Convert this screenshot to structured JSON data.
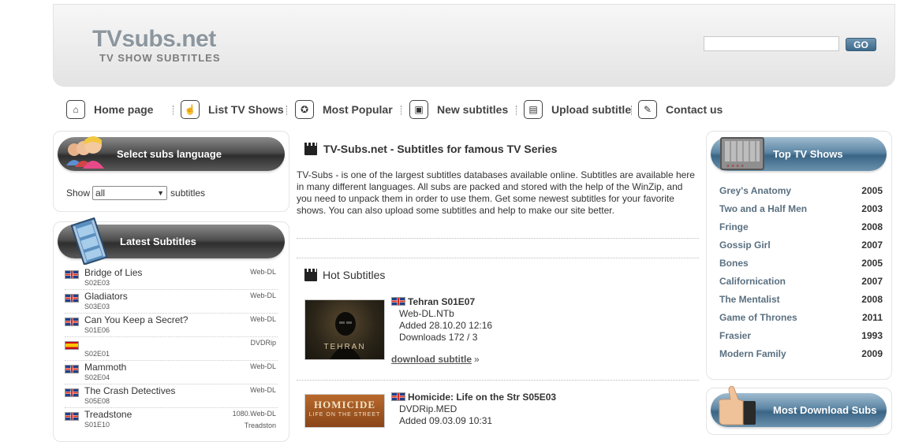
{
  "header": {
    "logo_main": "TVsubs.net",
    "logo_sub": "TV SHOW SUBTITLES"
  },
  "search": {
    "placeholder": "",
    "button_label": "GO"
  },
  "nav": {
    "items": [
      {
        "label": "Home page",
        "icon": "home-icon"
      },
      {
        "label": "List TV Shows",
        "icon": "hand-icon"
      },
      {
        "label": "Most Popular",
        "icon": "popular-icon"
      },
      {
        "label": "New subtitles",
        "icon": "new-icon"
      },
      {
        "label": "Upload subtitle",
        "icon": "upload-icon"
      },
      {
        "label": "Contact us",
        "icon": "contact-icon"
      }
    ]
  },
  "language_panel": {
    "title": "Select subs language",
    "show_label": "Show",
    "selected": "all",
    "suffix": "subtitles"
  },
  "latest_panel": {
    "title": "Latest Subtitles",
    "items": [
      {
        "title": "Bridge of Lies",
        "episode": "S02E03",
        "type": "Web-DL",
        "type2": "",
        "flag": "uk"
      },
      {
        "title": "Gladiators",
        "episode": "S03E03",
        "type": "Web-DL",
        "type2": "",
        "flag": "uk"
      },
      {
        "title": "Can You Keep a Secret?",
        "episode": "S01E06",
        "type": "Web-DL",
        "type2": "",
        "flag": "uk"
      },
      {
        "title": "",
        "episode": "S02E01",
        "type": "DVDRip",
        "type2": "",
        "flag": "es"
      },
      {
        "title": "Mammoth",
        "episode": "S02E04",
        "type": "Web-DL",
        "type2": "",
        "flag": "uk"
      },
      {
        "title": "The Crash Detectives",
        "episode": "S05E08",
        "type": "Web-DL",
        "type2": "",
        "flag": "uk"
      },
      {
        "title": "Treadstone",
        "episode": "S01E10",
        "type": "1080.Web-DL",
        "type2": "Treadston",
        "flag": "uk"
      }
    ]
  },
  "main": {
    "intro_title": "TV-Subs.net - Subtitles for famous TV Series",
    "intro_text": "TV-Subs - is one of the largest subtitles databases available online. Subtitles are available here in many different languages. All subs are packed and stored with the help of the WinZip, and you need to unpack them in order to use them. Get some newest subtitles for your favorite shows. You can also upload some subtitles and help to make our site better.",
    "hot_title": "Hot Subtitles",
    "hot": [
      {
        "title": "Tehran S01E07",
        "release": "Web-DL.NTb",
        "added": "Added 28.10.20 12:16",
        "downloads": "Downloads 172 / 3",
        "poster_text": "TEHRAN"
      },
      {
        "title": "Homicide: Life on the Str S05E03",
        "release": "DVDRip.MED",
        "added": "Added 09.03.09 10:31",
        "downloads": "",
        "poster_text": "HOMICIDE",
        "poster_sub": "LIFE ON THE STREET"
      }
    ],
    "download_label": "download subtitle",
    "download_arrow": "»"
  },
  "top_shows": {
    "title": "Top TV Shows",
    "items": [
      {
        "name": "Grey's Anatomy",
        "year": "2005"
      },
      {
        "name": "Two and a Half Men",
        "year": "2003"
      },
      {
        "name": "Fringe",
        "year": "2008"
      },
      {
        "name": "Gossip Girl",
        "year": "2007"
      },
      {
        "name": "Bones",
        "year": "2005"
      },
      {
        "name": "Californication",
        "year": "2007"
      },
      {
        "name": "The Mentalist",
        "year": "2008"
      },
      {
        "name": "Game of Thrones",
        "year": "2011"
      },
      {
        "name": "Frasier",
        "year": "1993"
      },
      {
        "name": "Modern Family",
        "year": "2009"
      }
    ]
  },
  "most_download": {
    "title": "Most Download Subs"
  },
  "colors": {
    "accent_blue": "#5d86a4",
    "link_blue": "#5a7080",
    "dark_pill": "#3a3a3a"
  }
}
